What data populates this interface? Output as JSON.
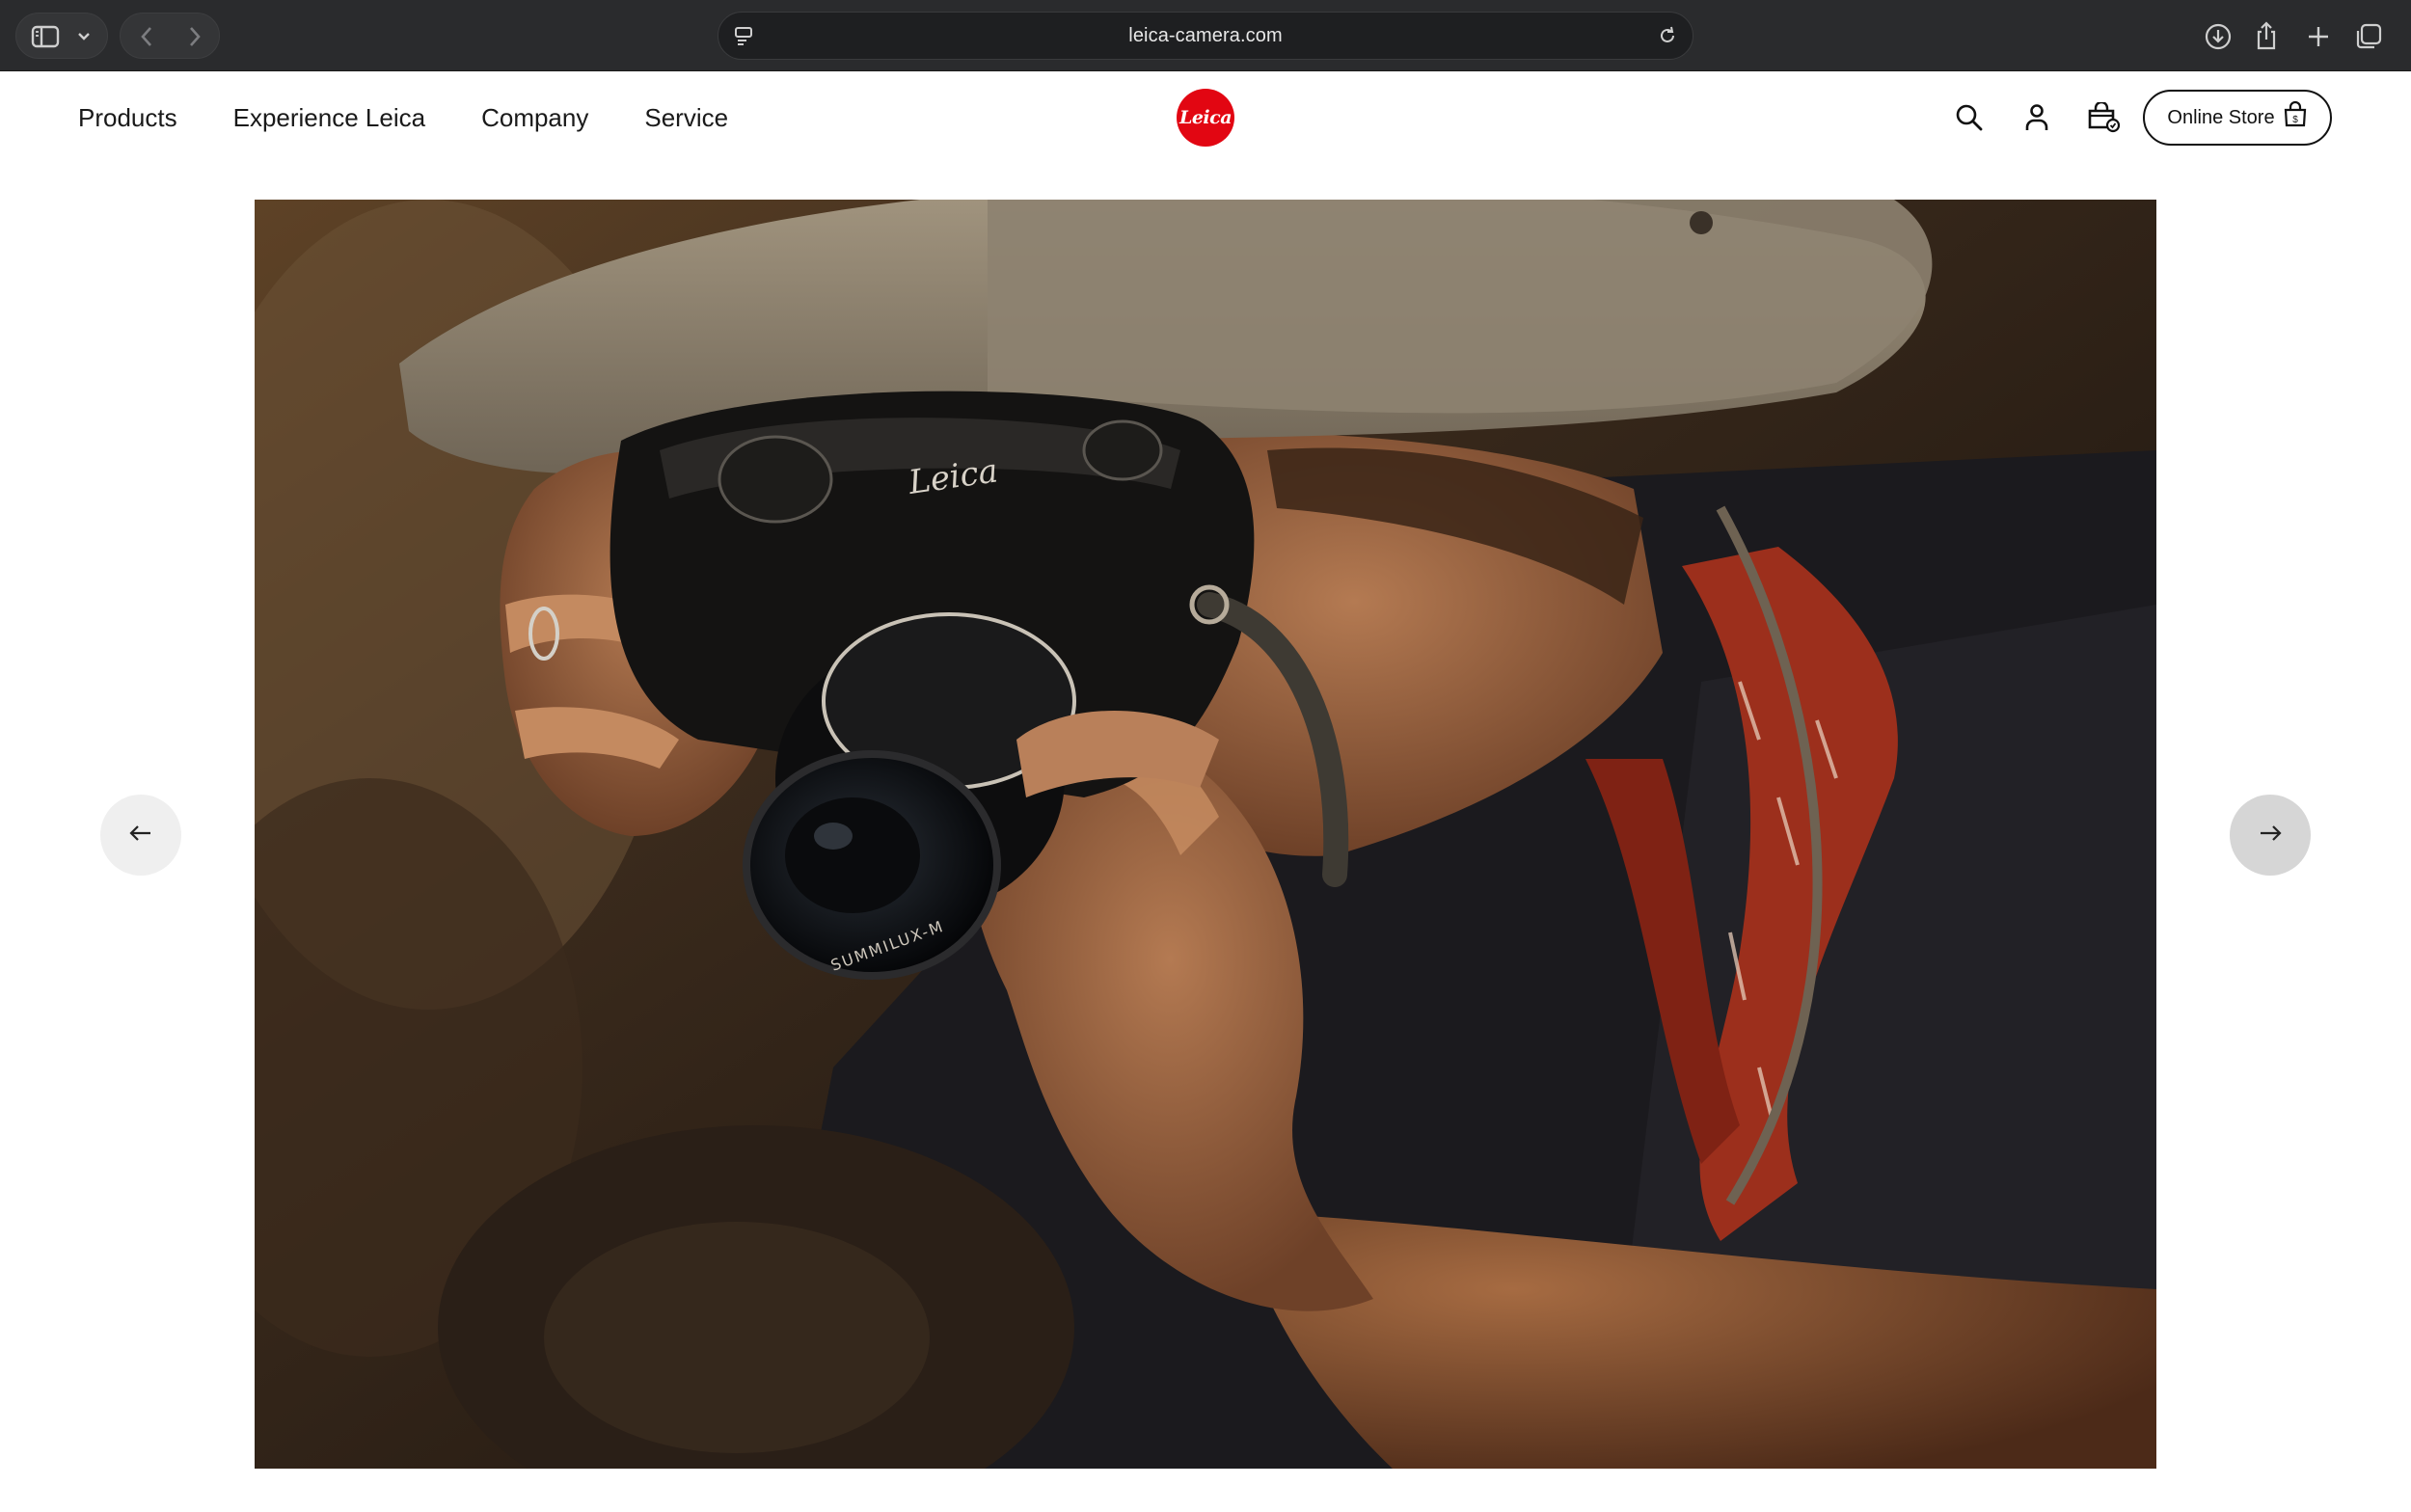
{
  "browser": {
    "url": "leica-camera.com"
  },
  "header": {
    "nav": [
      "Products",
      "Experience Leica",
      "Company",
      "Service"
    ],
    "logo_text": "Leica",
    "online_store_label": "Online Store"
  },
  "icons": {
    "sidebar": "sidebar-icon",
    "search": "search-icon",
    "account": "user-icon",
    "cart": "cart-icon",
    "store_bag": "shopping-bag-icon",
    "prev": "arrow-left-icon",
    "next": "arrow-right-icon"
  },
  "colors": {
    "brand_red": "#e20612",
    "chrome_bg": "#2a2b2d",
    "text": "#1a1a1a"
  },
  "hero": {
    "lens_engraving": "SUMMILUX-M",
    "camera_script": "Leica"
  }
}
